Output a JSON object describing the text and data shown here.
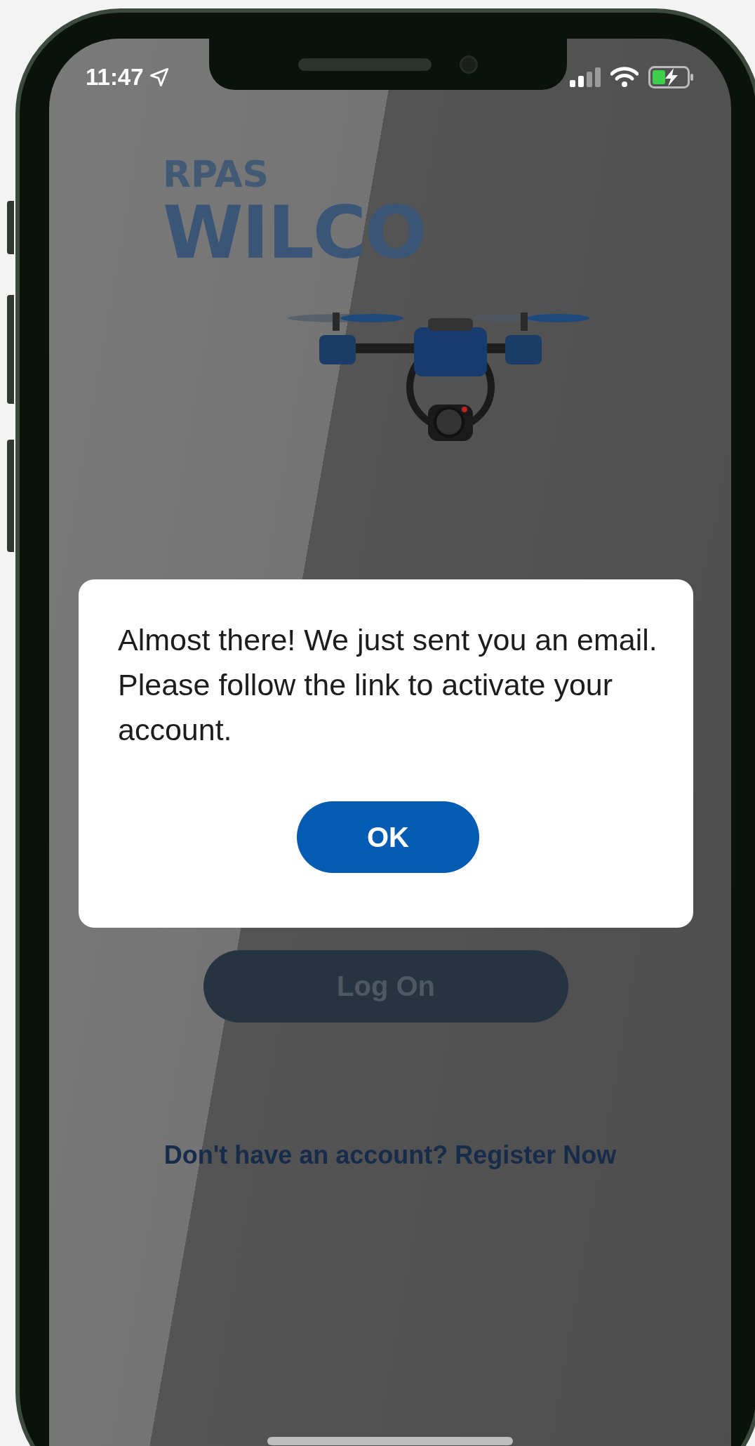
{
  "status_bar": {
    "time": "11:47"
  },
  "logo": {
    "line_1": "RPAS",
    "line_2": "WILCO"
  },
  "login_button": {
    "label": "Log On"
  },
  "register_link": {
    "label": "Don't have an account? Register Now"
  },
  "alert": {
    "message": "Almost there! We just sent you an email. Please follow the link to activate your account.",
    "button": "OK"
  }
}
